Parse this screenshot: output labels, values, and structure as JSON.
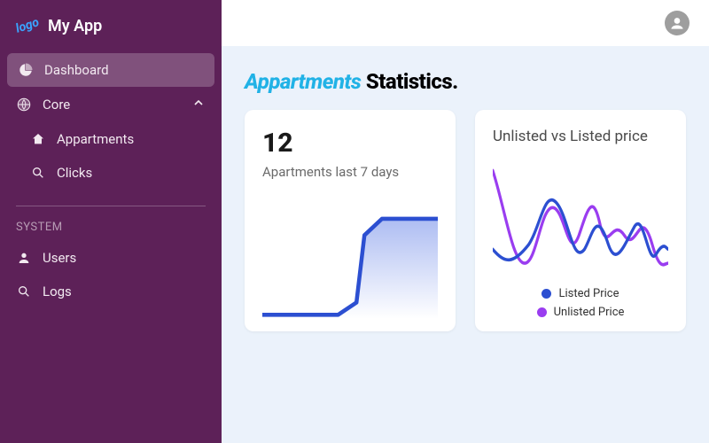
{
  "brand": {
    "logo_text": "logo",
    "name": "My App"
  },
  "sidebar": {
    "items": [
      {
        "id": "dashboard",
        "label": "Dashboard",
        "icon": "pie-icon",
        "active": true
      },
      {
        "id": "core",
        "label": "Core",
        "icon": "globe-icon",
        "expandable": true,
        "expanded": true
      },
      {
        "id": "appartments",
        "label": "Appartments",
        "icon": "home-icon",
        "child": true
      },
      {
        "id": "clicks",
        "label": "Clicks",
        "icon": "search-icon",
        "child": true
      }
    ],
    "system_label": "SYSTEM",
    "system_items": [
      {
        "id": "users",
        "label": "Users",
        "icon": "user-icon"
      },
      {
        "id": "logs",
        "label": "Logs",
        "icon": "search-icon"
      }
    ]
  },
  "page": {
    "title_accent": "Appartments",
    "title_rest": "Statistics."
  },
  "cards": {
    "stat": {
      "number": "12",
      "subtitle": "Apartments last 7 days"
    },
    "compare": {
      "title": "Unlisted vs Listed price",
      "legend": [
        {
          "label": "Listed Price",
          "color": "#2c4fd1"
        },
        {
          "label": "Unlisted Price",
          "color": "#9a3df0"
        }
      ]
    }
  },
  "chart_data": [
    {
      "type": "area",
      "title": "Apartments last 7 days",
      "xlabel": "",
      "ylabel": "",
      "x": [
        0,
        1,
        2,
        3,
        4,
        5,
        6
      ],
      "series": [
        {
          "name": "Apartments",
          "values": [
            0,
            0,
            0,
            1,
            10,
            12,
            12
          ],
          "color": "#2c4fd1"
        }
      ],
      "ylim": [
        0,
        12
      ]
    },
    {
      "type": "line",
      "title": "Unlisted vs Listed price",
      "xlabel": "",
      "ylabel": "",
      "x": [
        0,
        1,
        2,
        3,
        4,
        5,
        6,
        7,
        8,
        9,
        10,
        11,
        12
      ],
      "series": [
        {
          "name": "Listed Price",
          "values": [
            3,
            2,
            2,
            4,
            8,
            3,
            2,
            6,
            3,
            2,
            5,
            2,
            3
          ],
          "color": "#2c4fd1"
        },
        {
          "name": "Unlisted Price",
          "values": [
            9,
            5,
            2,
            3,
            6,
            7,
            3,
            5,
            8,
            3,
            4,
            6,
            2
          ],
          "color": "#9a3df0"
        }
      ],
      "ylim": [
        0,
        10
      ]
    }
  ]
}
